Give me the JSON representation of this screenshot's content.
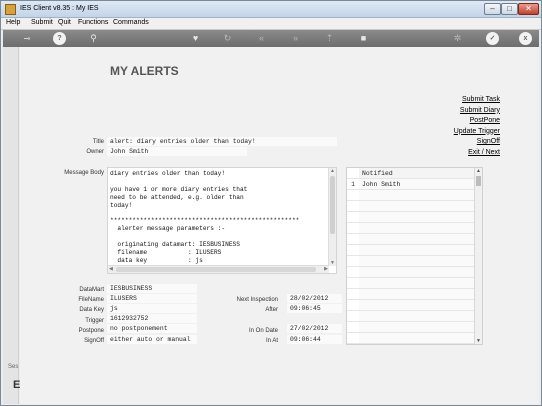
{
  "window": {
    "title": "IES Client v8.35 : My IES",
    "minimize": "–",
    "maximize": "□",
    "close": "✕"
  },
  "menu": [
    "Help",
    "Submit",
    "Quit",
    "Functions",
    "Commands"
  ],
  "toolbar_icons": [
    "key-icon",
    "help-icon",
    "search-icon",
    "heart-icon",
    "refresh-icon",
    "rewind-icon",
    "fast-forward-icon",
    "upload-icon",
    "stop-icon",
    "settings-icon",
    "ok-icon",
    "close-icon"
  ],
  "toolbar_glyphs": {
    "help": "?",
    "ok": "✓",
    "close": "x"
  },
  "page": {
    "title": "MY ALERTS",
    "actions": [
      "Submit Task",
      "Submit Diary",
      "PostPone",
      "Update Trigger",
      "SignOff",
      "Exit / Next"
    ]
  },
  "form": {
    "title_label": "Title",
    "title_value": "alert: diary entries older than today!",
    "owner_label": "Owner",
    "owner_value": "John Smith",
    "message_label": "Message Body",
    "message_body": "diary entries older than today!\n\nyou have 1 or more diary entries that\nneed to be attended, e.g. older than\ntoday!\n\n***************************************************\n  alerter message parameters :-\n\n  originating datamart: IESBUSINESS\n  filename           : ILUSERS\n  data key           : js",
    "datamart_label": "DataMart",
    "datamart_value": "IESBUSINESS",
    "filename_label": "FileName",
    "filename_value": "ILUSERS",
    "datakey_label": "Data Key",
    "datakey_value": "js",
    "trigger_label": "Trigger",
    "trigger_value": "1612932752",
    "postpone_label": "Postpone",
    "postpone_value": "no postponement",
    "signoff_label": "SignOff",
    "signoff_value": "either auto or manual",
    "next_inspection_label": "Next Inspection",
    "next_inspection_value": "28/02/2012",
    "after_label": "After",
    "after_value": "09:06:45",
    "on_date_label": "In On Date",
    "on_date_value": "27/02/2012",
    "in_at_label": "In At",
    "in_at_value": "09:06:44"
  },
  "notified": {
    "header": "Notified",
    "rows": [
      {
        "num": "1",
        "name": "John Smith"
      }
    ]
  },
  "left_strip": {
    "text": "Ses",
    "letter": "E"
  }
}
